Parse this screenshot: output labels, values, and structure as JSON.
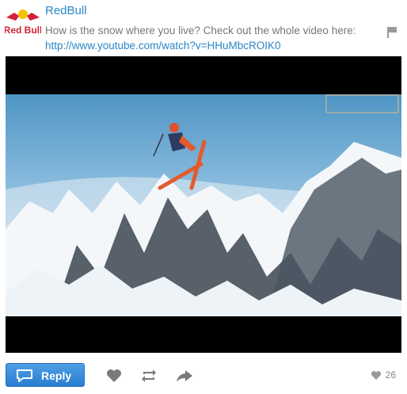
{
  "post": {
    "author": "RedBull",
    "message": "How is the snow where you live? Check out the whole video here:",
    "link": "http://www.youtube.com/watch?v=HHuMbcROIK0"
  },
  "logo": {
    "icon": "redbull-logo",
    "brand_text": "Red Bull"
  },
  "actions": {
    "reply_label": "Reply",
    "like_count": "26"
  },
  "colors": {
    "link": "#2a86c8",
    "reply_button": "#2a7cd0",
    "logo_red": "#d51f35",
    "logo_navy": "#1c2a5a"
  }
}
